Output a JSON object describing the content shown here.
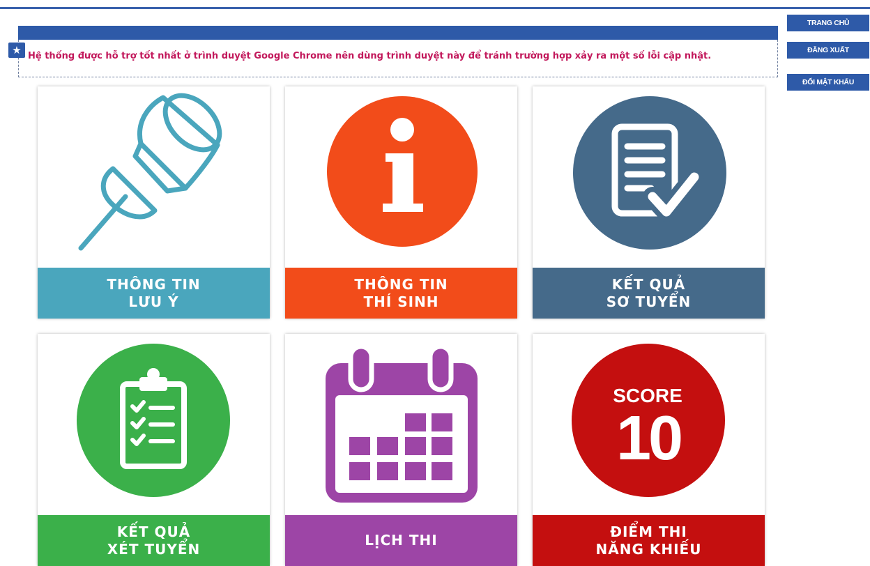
{
  "notice": {
    "text": "Hệ thống được hỗ trợ tốt nhất ở trình duyệt Google Chrome nên dùng trình duyệt này để tránh trường hợp xảy ra một số lỗi cập nhật.",
    "icon": "star-icon"
  },
  "nav": {
    "home": "TRANG CHỦ",
    "logout": "ĐĂNG XUẤT",
    "change_password": "ĐỔI MẬT KHẨU"
  },
  "tiles": [
    {
      "line1": "THÔNG TIN",
      "line2": "LƯU Ý",
      "color": "#4aa6bd",
      "icon": "pushpin-icon"
    },
    {
      "line1": "THÔNG TIN",
      "line2": "THÍ SINH",
      "color": "#f24c1a",
      "icon": "info-icon"
    },
    {
      "line1": "KẾT QUẢ",
      "line2": "SƠ TUYỂN",
      "color": "#456a8a",
      "icon": "document-check-icon"
    },
    {
      "line1": "KẾT QUẢ",
      "line2": "XÉT TUYỂN",
      "color": "#3bb04a",
      "icon": "clipboard-checklist-icon"
    },
    {
      "line1": "LỊCH THI",
      "line2": "",
      "color": "#9d45a6",
      "icon": "calendar-icon"
    },
    {
      "line1": "ĐIỂM THI",
      "line2": "NĂNG KHIẾU",
      "color": "#c40f0f",
      "icon": "score-badge-icon"
    }
  ],
  "score_icon": {
    "top": "SCORE",
    "number": "10"
  }
}
